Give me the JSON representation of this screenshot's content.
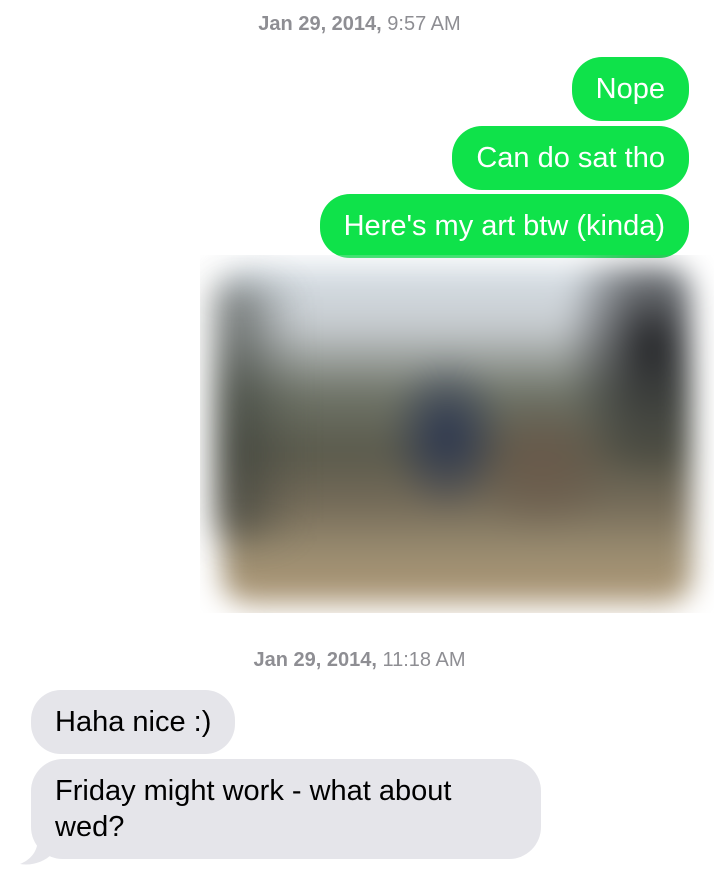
{
  "conversation": {
    "sections": [
      {
        "timestamp": {
          "date": "Jan 29, 2014,",
          "time": "9:57 AM"
        }
      },
      {
        "timestamp": {
          "date": "Jan 29, 2014,",
          "time": "11:18 AM"
        }
      }
    ],
    "sent_messages": [
      {
        "text": "Nope"
      },
      {
        "text": "Can do sat tho"
      },
      {
        "text": "Here's my art btw (kinda)"
      }
    ],
    "received_messages": [
      {
        "text": "Haha nice :)"
      },
      {
        "text": "Friday might work - what about wed?"
      }
    ],
    "colors": {
      "sent_bubble": "#0fe24a",
      "received_bubble": "#e5e5ea",
      "timestamp_text": "#8e8e93"
    }
  }
}
